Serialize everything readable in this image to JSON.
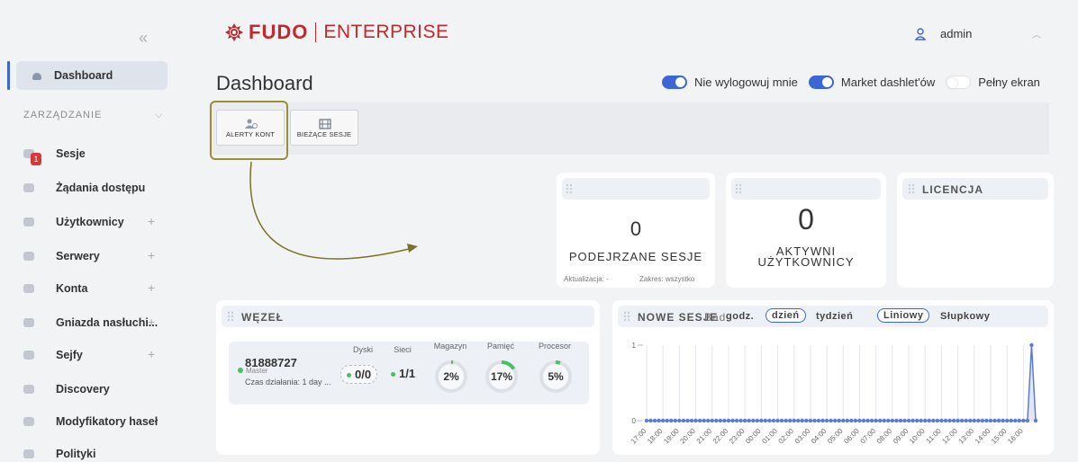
{
  "sidebar": {
    "collapse_icon": "double-chevron-left-icon",
    "active_item": {
      "label": "Dashboard",
      "icon": "dashboard-icon"
    },
    "section_label": "ZARZĄDZANIE",
    "items": [
      {
        "label": "Sesje",
        "icon": "sessions-icon",
        "plus": ""
      },
      {
        "label": "Żądania dostępu",
        "icon": "access-request-icon",
        "plus": "",
        "badge": "1"
      },
      {
        "label": "Użytkownicy",
        "icon": "users-icon",
        "plus": "+"
      },
      {
        "label": "Serwery",
        "icon": "servers-icon",
        "plus": "+"
      },
      {
        "label": "Konta",
        "icon": "accounts-icon",
        "plus": "+"
      },
      {
        "label": "Gniazda nasłuchi...",
        "icon": "listener-icon",
        "plus": "+"
      },
      {
        "label": "Sejfy",
        "icon": "safes-icon",
        "plus": "+"
      },
      {
        "label": "Discovery",
        "icon": "discovery-icon",
        "plus": ""
      },
      {
        "label": "Modyfikatory haseł",
        "icon": "password-modifiers-icon",
        "plus": ""
      },
      {
        "label": "Polityki",
        "icon": "policies-icon",
        "plus": ""
      }
    ]
  },
  "header": {
    "logo_fudo": "FUDO",
    "logo_enterprise": "ENTERPRISE",
    "user": "admin",
    "brand_color": "#c3282b"
  },
  "page": {
    "title": "Dashboard"
  },
  "toggles": [
    {
      "label": "Nie wylogowuj mnie",
      "on": true
    },
    {
      "label": "Market dashlet'ów",
      "on": true
    },
    {
      "label": "Pełny ekran",
      "on": false
    }
  ],
  "toolbar": {
    "buttons": [
      {
        "label": "ALERTY KONT",
        "icon": "user-alert-icon"
      },
      {
        "label": "BIEŻĄCE SESJE",
        "icon": "film-icon"
      }
    ]
  },
  "cards": {
    "suspicious": {
      "value": "0",
      "label": "PODEJRZANE SESJE",
      "updated": "Aktualizacja: -",
      "range": "Zakres: wszystko"
    },
    "active_users": {
      "value": "0",
      "label_line1": "AKTYWNI",
      "label_line2": "UŻYTKOWNICY"
    },
    "license": {
      "title": "LICENCJA"
    }
  },
  "node": {
    "title": "WĘZEŁ",
    "id": "81888727",
    "role": "Master",
    "uptime": "Czas działania: 1 day ...",
    "labels": {
      "disks": "Dyski",
      "networks": "Sieci",
      "storage": "Magazyn",
      "memory": "Pamięć",
      "cpu": "Procesor"
    },
    "disks": "0/0",
    "networks": "1/1",
    "storage": "2%",
    "memory": "17%",
    "cpu": "5%"
  },
  "new_sessions": {
    "title": "NOWE SESJE",
    "overlap_label": "Bad",
    "range_options": [
      "godz.",
      "dzień",
      "tydzień"
    ],
    "selected_range": "dzień",
    "type_options": [
      "Liniowy",
      "Słupkowy"
    ],
    "selected_type": "Liniowy"
  },
  "chart_data": {
    "type": "line",
    "x": [
      "17:00",
      "18:00",
      "19:00",
      "20:00",
      "21:00",
      "22:00",
      "23:00",
      "00:00",
      "01:00",
      "02:00",
      "03:00",
      "04:00",
      "05:00",
      "06:00",
      "07:00",
      "08:00",
      "09:00",
      "10:00",
      "11:00",
      "12:00",
      "13:00",
      "14:00",
      "15:00",
      "16:00"
    ],
    "yticks": [
      0,
      1
    ],
    "ylim": [
      0,
      1
    ],
    "points_per_hour": 4,
    "peak_index": 94,
    "series": [
      {
        "values_note": "all zero except one point",
        "peak": 1
      }
    ],
    "color": "#5b7bd8"
  }
}
